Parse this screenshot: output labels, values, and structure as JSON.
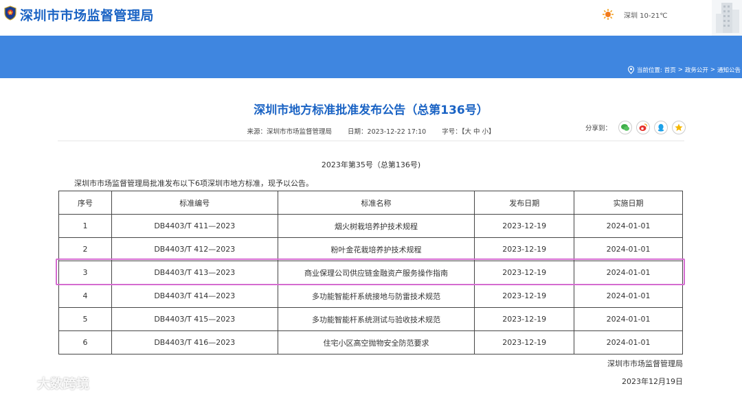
{
  "header": {
    "site_title": "深圳市市场监督管理局",
    "weather_icon": "sun-icon",
    "weather_text": "深圳 10-21℃"
  },
  "breadcrumb": {
    "label": "当前位置:",
    "items": [
      "首页",
      "政务公开",
      "通知公告"
    ],
    "separator": ">"
  },
  "article": {
    "title": "深圳市地方标准批准发布公告（总第136号）",
    "source": "来源：深圳市市场监督管理局",
    "date": "日期：2023-12-22 17:10",
    "font_size_label": "字号：【大 中 小】",
    "share_label": "分享到：",
    "share_icons": [
      "wechat-icon",
      "weibo-icon",
      "qq-icon",
      "qzone-icon"
    ],
    "subhead": "2023年第35号（总第136号)",
    "intro": "深圳市市场监督管理局批准发布以下6项深圳市地方标准，现予以公告。"
  },
  "table": {
    "headers": [
      "序号",
      "标准编号",
      "标准名称",
      "发布日期",
      "实施日期"
    ],
    "rows": [
      [
        "1",
        "DB4403/T 411—2023",
        "烟火树栽培养护技术规程",
        "2023-12-19",
        "2024-01-01"
      ],
      [
        "2",
        "DB4403/T 412—2023",
        "粉叶金花栽培养护技术规程",
        "2023-12-19",
        "2024-01-01"
      ],
      [
        "3",
        "DB4403/T 413—2023",
        "商业保理公司供应链金融资产服务操作指南",
        "2023-12-19",
        "2024-01-01"
      ],
      [
        "4",
        "DB4403/T 414—2023",
        "多功能智能杆系统接地与防雷技术规范",
        "2023-12-19",
        "2024-01-01"
      ],
      [
        "5",
        "DB4403/T 415—2023",
        "多功能智能杆系统测试与验收技术规范",
        "2023-12-19",
        "2024-01-01"
      ],
      [
        "6",
        "DB4403/T 416—2023",
        "住宅小区高空抛物安全防范要求",
        "2023-12-19",
        "2024-01-01"
      ]
    ]
  },
  "footer": {
    "signature": "深圳市市场监督管理局",
    "date": "2023年12月19日"
  },
  "watermark": {
    "text": "大数跨境"
  },
  "colors": {
    "brand_blue": "#1a63c4",
    "banner_blue": "#3f86e0",
    "highlight": "#d46bd0"
  }
}
